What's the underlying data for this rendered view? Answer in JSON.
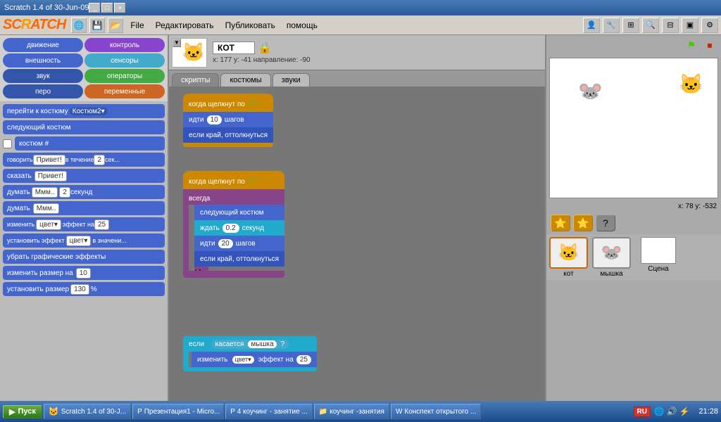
{
  "titlebar": {
    "title": "Scratch 1.4 of 30-Jun-09",
    "controls": [
      "_",
      "□",
      "×"
    ]
  },
  "menubar": {
    "file": "File",
    "edit": "Редактировать",
    "publish": "Публиковать",
    "help": "помощь"
  },
  "categories": [
    {
      "label": "движение",
      "class": "cat-blue"
    },
    {
      "label": "контроль",
      "class": "cat-purple"
    },
    {
      "label": "внешность",
      "class": "cat-blue"
    },
    {
      "label": "сенсоры",
      "class": "cat-teal"
    },
    {
      "label": "звук",
      "class": "cat-darkblue"
    },
    {
      "label": "операторы",
      "class": "cat-green"
    },
    {
      "label": "перо",
      "class": "cat-darkblue"
    },
    {
      "label": "переменные",
      "class": "cat-orange"
    }
  ],
  "blocks": [
    {
      "label": "перейти к костюму Костюм2▾",
      "class": "block-blue"
    },
    {
      "label": "следующий костюм",
      "class": "block-blue"
    },
    {
      "label": "костюм #",
      "class": "block-blue"
    },
    {
      "label": "говорить Привет! в течение 2 сек...",
      "class": "block-blue"
    },
    {
      "label": "сказать Привет!",
      "class": "block-blue"
    },
    {
      "label": "думать Ммм.. 2 секунд",
      "class": "block-blue"
    },
    {
      "label": "думать Ммм..",
      "class": "block-blue"
    },
    {
      "label": "изменить цвет▾ эффект на 25",
      "class": "block-blue"
    },
    {
      "label": "установить эффект цвет▾ в значени...",
      "class": "block-blue"
    },
    {
      "label": "убрать графические эффекты",
      "class": "block-blue"
    },
    {
      "label": "изменить размер на 10",
      "class": "block-blue"
    },
    {
      "label": "установить размер 130 %",
      "class": "block-blue"
    }
  ],
  "sprite": {
    "name": "КОТ",
    "x": "177",
    "y": "-41",
    "direction": "-90",
    "coords_label": "x: 177  y: -41  направление: -90"
  },
  "tabs": [
    {
      "label": "скрипты",
      "active": true
    },
    {
      "label": "костюмы",
      "active": false
    },
    {
      "label": "звуки",
      "active": false
    }
  ],
  "scripts": {
    "group1": {
      "hat": "когда щелкнут по 🏳",
      "blocks": [
        {
          "text": "идти",
          "value": "10",
          "suffix": "шагов"
        },
        {
          "text": "если край, оттолкнуться"
        }
      ]
    },
    "group2": {
      "hat": "когда щелкнут по 🏳",
      "blocks": [
        {
          "text": "всегда",
          "isWrap": true
        },
        {
          "text": "следующий костюм"
        },
        {
          "text": "ждать",
          "value": "0.2",
          "suffix": "секунд"
        },
        {
          "text": "идти",
          "value": "20",
          "suffix": "шагов"
        },
        {
          "text": "если край, оттолкнуться"
        }
      ]
    },
    "group3": {
      "hat": "если",
      "blocks": [
        {
          "text": "касается",
          "value": "мышка",
          "suffix": "?"
        },
        {
          "text": "изменить",
          "value": "цвет▾",
          "suffix": "эффект на 25"
        }
      ]
    }
  },
  "stage": {
    "coords": "x: 78   y: -532"
  },
  "sprites": [
    {
      "label": "кот",
      "emoji": "🐱",
      "selected": true
    },
    {
      "label": "мышка",
      "emoji": "🐭",
      "selected": false
    }
  ],
  "scene_label": "Сцена",
  "taskbar": {
    "start": "Пуск",
    "buttons": [
      "Scratch 1.4 of 30-J...",
      "Презентация1 - Micro...",
      "4 коучинг - занятие ...",
      "коучинг -занятия",
      "Конспект открытого ..."
    ],
    "lang": "RU",
    "time": "21:28"
  }
}
